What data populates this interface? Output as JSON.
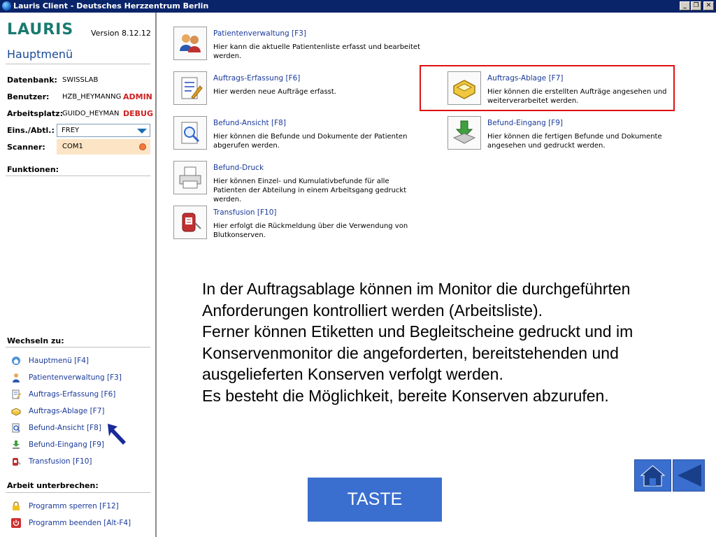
{
  "window": {
    "title": "Lauris Client - Deutsches Herzzentrum Berlin",
    "buttons": [
      "_",
      "❐",
      "✕"
    ]
  },
  "sidebar": {
    "logo": "LAURIS",
    "version": "Version 8.12.12",
    "heading": "Hauptmenü",
    "fields": {
      "datenbank": {
        "label": "Datenbank:",
        "value": "SWISSLAB"
      },
      "benutzer": {
        "label": "Benutzer:",
        "value": "HZB_HEYMANNG",
        "flag": "ADMIN"
      },
      "arbeitsplatz": {
        "label": "Arbeitsplatz:",
        "value": "GUIDO_HEYMAN",
        "flag": "DEBUG"
      },
      "einsatz": {
        "label": "Eins./Abtl.:",
        "value": "FREY"
      },
      "scanner": {
        "label": "Scanner:",
        "value": "COM1"
      }
    },
    "funktionen_label": "Funktionen:",
    "wechseln_label": "Wechseln zu:",
    "wechseln_items": [
      {
        "label": "Hauptmenü [F4]",
        "icon": "home-icon"
      },
      {
        "label": "Patientenverwaltung [F3]",
        "icon": "person-icon"
      },
      {
        "label": "Auftrags-Erfassung [F6]",
        "icon": "edit-document-icon"
      },
      {
        "label": "Auftrags-Ablage [F7]",
        "icon": "tray-icon"
      },
      {
        "label": "Befund-Ansicht [F8]",
        "icon": "magnifier-icon"
      },
      {
        "label": "Befund-Eingang [F9]",
        "icon": "download-icon"
      },
      {
        "label": "Transfusion [F10]",
        "icon": "blood-bag-icon"
      }
    ],
    "unterbrechen_label": "Arbeit unterbrechen:",
    "unterbrechen_items": [
      {
        "label": "Programm sperren [F12]",
        "icon": "lock-icon"
      },
      {
        "label": "Programm beenden [Alt-F4]",
        "icon": "power-icon"
      }
    ]
  },
  "main": {
    "entries": [
      {
        "title": "Patientenverwaltung [F3]",
        "desc": "Hier kann die aktuelle Patientenliste erfasst und bearbeitet werden.",
        "icon": "patients-icon"
      },
      {
        "title": "Auftrags-Erfassung [F6]",
        "desc": "Hier werden neue Aufträge erfasst.",
        "icon": "edit-document-icon"
      },
      {
        "title": "Auftrags-Ablage [F7]",
        "desc": "Hier können die erstellten Aufträge angesehen und weiterverarbeitet werden.",
        "icon": "tray-icon"
      },
      {
        "title": "Befund-Ansicht [F8]",
        "desc": "Hier können die Befunde und Dokumente der Patienten abgerufen werden.",
        "icon": "magnifier-icon"
      },
      {
        "title": "Befund-Eingang [F9]",
        "desc": "Hier können die fertigen Befunde und Dokumente angesehen und gedruckt werden.",
        "icon": "download-icon"
      },
      {
        "title": "Befund-Druck",
        "desc": "Hier können Einzel- und Kumulativbefunde für alle Patienten der Abteilung in einem Arbeitsgang gedruckt werden.",
        "icon": "printer-icon"
      },
      {
        "title": "Transfusion [F10]",
        "desc": "Hier erfolgt die Rückmeldung über die Verwendung von Blutkonserven.",
        "icon": "blood-bag-icon"
      }
    ],
    "info_lines": [
      "In der Auftragsablage können im Monitor die durchgeführten",
      "Anforderungen kontrolliert werden (Arbeitsliste).",
      "Ferner können Etiketten und Begleitscheine gedruckt und im",
      "Konservenmonitor die angeforderten, bereitstehenden und",
      "ausgelieferten Konserven verfolgt werden.",
      "Es besteht die Möglichkeit, bereite Konserven abzurufen."
    ],
    "taste_label": "TASTE"
  },
  "colors": {
    "accent_blue": "#3a6fcf",
    "link_blue": "#1a3a9a",
    "alert_red": "#d02020",
    "highlight_red": "#e01010",
    "logo_teal": "#1a7a70"
  }
}
